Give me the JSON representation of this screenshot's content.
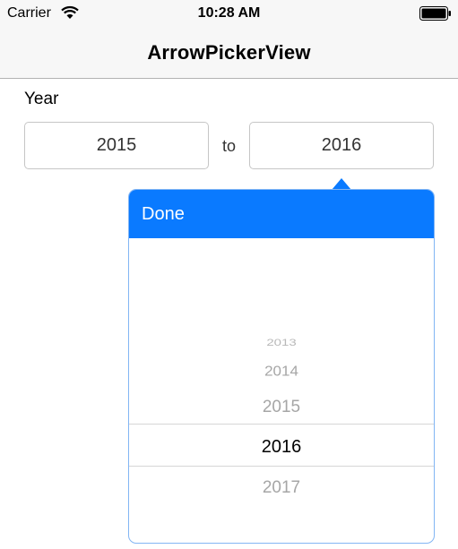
{
  "status_bar": {
    "carrier": "Carrier",
    "time": "10:28 AM",
    "wifi_icon": "wifi-icon",
    "battery_icon": "battery-icon"
  },
  "nav_bar": {
    "title": "ArrowPickerView"
  },
  "form": {
    "year_label": "Year",
    "from_value": "2015",
    "to_label": "to",
    "to_value": "2016"
  },
  "picker": {
    "done_label": "Done",
    "rows": [
      "2013",
      "2014",
      "2015",
      "2016",
      "2017"
    ],
    "selected": "2016"
  },
  "colors": {
    "accent": "#0a7aff",
    "popover_border": "#82b5f4",
    "nav_background": "#f7f7f7",
    "field_border": "#c6c6c6"
  }
}
